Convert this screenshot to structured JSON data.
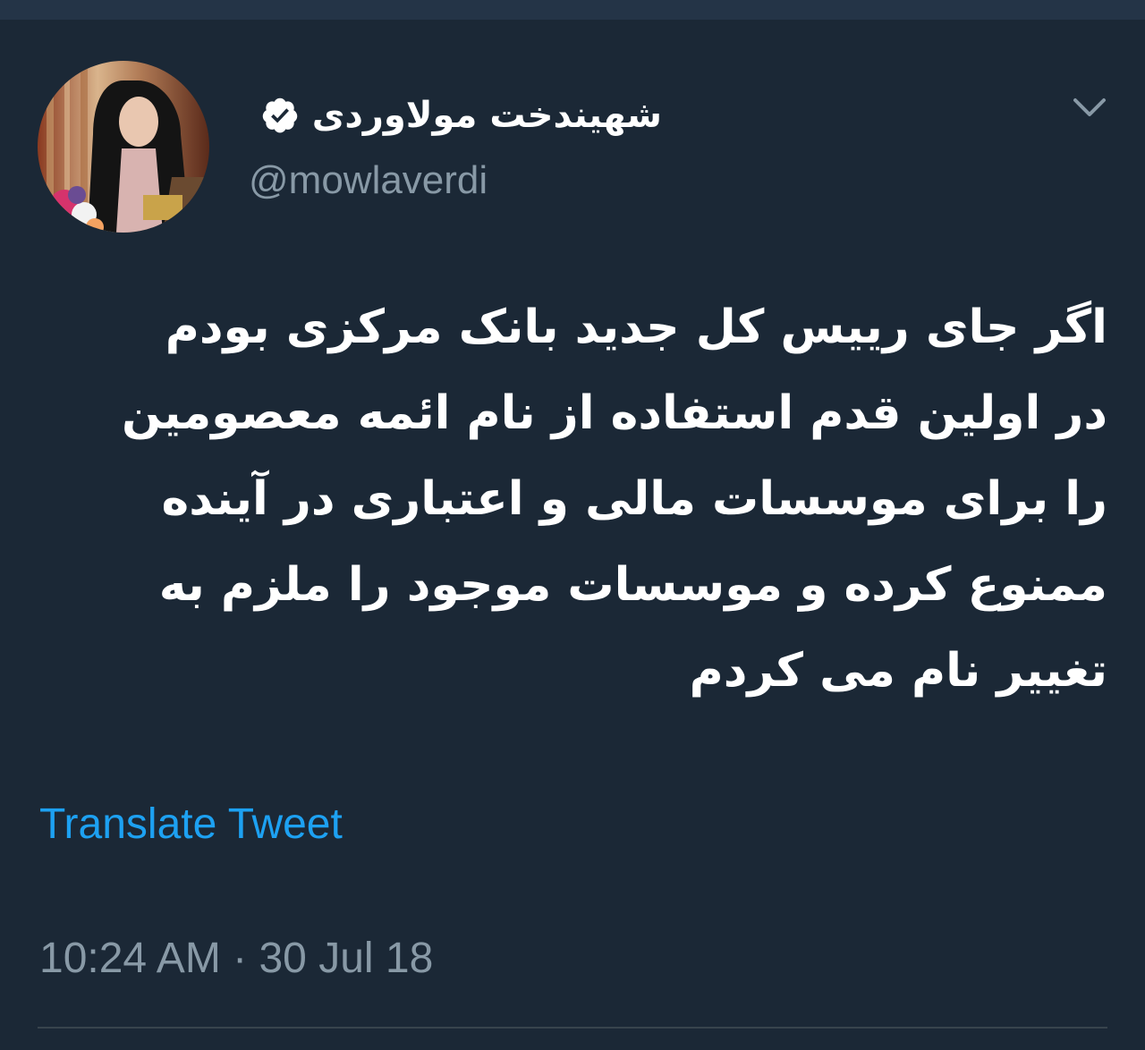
{
  "colors": {
    "background": "#1b2836",
    "text": "#ffffff",
    "secondary": "#8899a6",
    "link": "#1da1f2"
  },
  "author": {
    "display_name": "شهیندخت مولاوردی",
    "handle": "@mowlaverdi",
    "verified_icon": "verified-badge-icon"
  },
  "menu": {
    "icon": "chevron-down-icon"
  },
  "tweet": {
    "text": "اگر جای رییس کل جدید بانک مرکزی بودم\nدر اولین قدم استفاده از نام ائمه معصومین\nرا برای موسسات مالی و اعتباری در آینده\nممنوع کرده و موسسات موجود را ملزم به\nتغییر نام می کردم",
    "translate_label": "Translate Tweet",
    "timestamp": "10:24 AM · 30 Jul 18"
  }
}
